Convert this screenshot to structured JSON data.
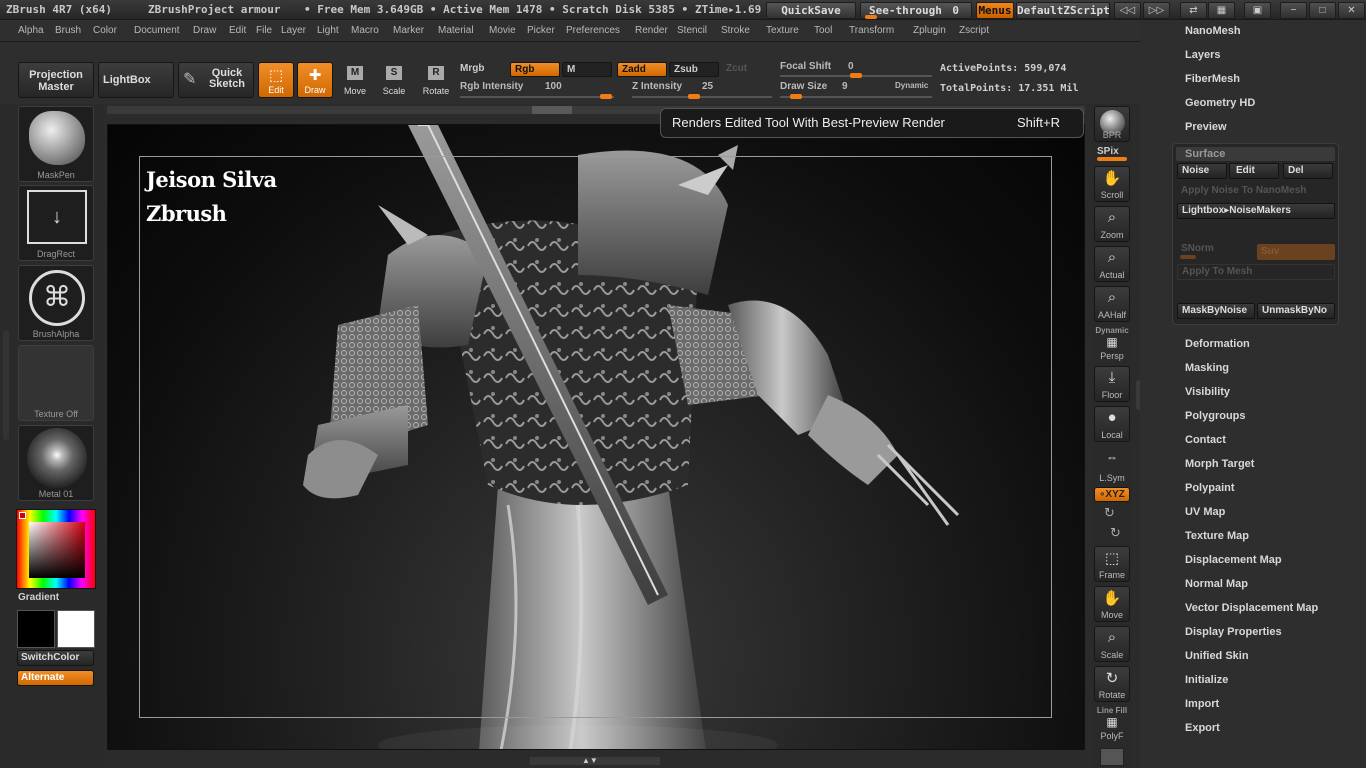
{
  "titlebar": {
    "app": "ZBrush 4R7 (x64)",
    "project": "ZBrushProject armour",
    "free_mem": "• Free Mem 3.649GB • Active Mem 1478 • Scratch Disk 5385 •",
    "ztime": "ZTime▸1.69",
    "quicksave": "QuickSave",
    "see_through": "See-through",
    "see_through_value": "0",
    "menus": "Menus",
    "default_zscript": "DefaultZScript"
  },
  "menubar": [
    "Alpha",
    "Brush",
    "Color",
    "Document",
    "Draw",
    "Edit",
    "File",
    "Layer",
    "Light",
    "Macro",
    "Marker",
    "Material",
    "Movie",
    "Picker",
    "Preferences",
    "Render",
    "Stencil",
    "Stroke",
    "Texture",
    "Tool",
    "Transform",
    "Zplugin",
    "Zscript"
  ],
  "toolbar": {
    "projection_master": "Projection Master",
    "lightbox": "LightBox",
    "quick_sketch": "Quick Sketch",
    "edit": "Edit",
    "draw": "Draw",
    "move": "Move",
    "scale": "Scale",
    "rotate": "Rotate",
    "mrgb": "Mrgb",
    "rgb": "Rgb",
    "m": "M",
    "zadd": "Zadd",
    "zsub": "Zsub",
    "zcut": "Zcut",
    "rgb_intensity_label": "Rgb Intensity",
    "rgb_intensity": "100",
    "z_intensity_label": "Z Intensity",
    "z_intensity": "25",
    "focal_shift_label": "Focal Shift",
    "focal_shift": "0",
    "draw_size_label": "Draw Size",
    "draw_size": "9",
    "dynamic": "Dynamic",
    "active_points": "ActivePoints: 599,074",
    "total_points": "TotalPoints: 17.351 Mil"
  },
  "leftshelf": {
    "brush": "MaskPen",
    "stroke": "DragRect",
    "alpha": "BrushAlpha",
    "texture": "Texture Off",
    "material": "Metal 01",
    "gradient": "Gradient",
    "switchcolor": "SwitchColor",
    "alternate": "Alternate"
  },
  "canvas": {
    "watermark_line1": "Jeison Silva",
    "watermark_line2": "Zbrush"
  },
  "tooltip": {
    "text": "Renders Edited Tool With Best-Preview Render",
    "shortcut": "Shift+R"
  },
  "rightshelf": {
    "bpr": "BPR",
    "spix": "SPix",
    "scroll": "Scroll",
    "zoom": "Zoom",
    "actual": "Actual",
    "aahalf": "AAHalf",
    "dynamic": "Dynamic",
    "persp": "Persp",
    "floor": "Floor",
    "local": "Local",
    "lsym": "L.Sym",
    "xyz": "∘XYZ",
    "frame": "Frame",
    "move": "Move",
    "scale": "Scale",
    "rotate": "Rotate",
    "linefill": "Line Fill",
    "polyf": "PolyF"
  },
  "palette": {
    "top_items": [
      "NanoMesh",
      "Layers",
      "FiberMesh",
      "Geometry HD",
      "Preview"
    ],
    "surface": {
      "title": "Surface",
      "noise": "Noise",
      "edit": "Edit",
      "del": "Del",
      "apply_noise": "Apply Noise To NanoMesh",
      "lightbox_noise": "Lightbox▸NoiseMakers",
      "snorm": "SNorm",
      "suv": "Suv",
      "apply_to_mesh": "Apply To Mesh",
      "maskbynoise": "MaskByNoise",
      "unmaskbynoise": "UnmaskByNo"
    },
    "bottom_items": [
      "Deformation",
      "Masking",
      "Visibility",
      "Polygroups",
      "Contact",
      "Morph Target",
      "Polypaint",
      "UV Map",
      "Texture Map",
      "Displacement Map",
      "Normal Map",
      "Vector Displacement Map",
      "Display Properties",
      "Unified Skin",
      "Initialize",
      "Import",
      "Export"
    ]
  },
  "colors": {
    "accent": "#f07d14",
    "primary_color": "#000000",
    "secondary_color": "#ffffff"
  }
}
